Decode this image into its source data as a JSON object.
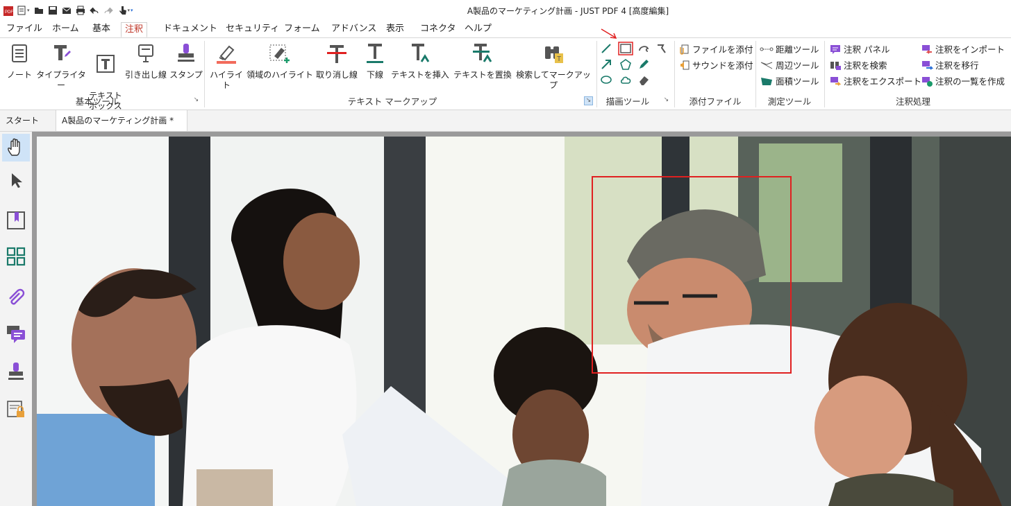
{
  "window": {
    "title": "A製品のマーケティング計画 - JUST PDF 4 [高度編集]"
  },
  "menu_tabs": [
    "ファイル",
    "ホーム",
    "基本",
    "注釈",
    "ドキュメント",
    "セキュリティ",
    "フォーム",
    "アドバンス",
    "表示",
    "コネクタ",
    "ヘルプ"
  ],
  "active_menu_tab": "注釈",
  "ribbon": {
    "basic_tools": {
      "label": "基本ツール",
      "buttons": [
        "ノート",
        "タイプライター",
        "テキスト\nボックス",
        "引き出し線",
        "スタンプ"
      ]
    },
    "text_markup": {
      "label": "テキスト マークアップ",
      "buttons": [
        "ハイライト",
        "領域のハイライト",
        "取り消し線",
        "下線",
        "テキストを挿入",
        "テキストを置換",
        "検索してマークアップ"
      ]
    },
    "drawing_tools": {
      "label": "描画ツール",
      "tools": [
        "line-icon",
        "rectangle-icon",
        "cloud-arc-icon",
        "eraser-pin-icon",
        "arrow-icon",
        "polygon-icon",
        "pencil-icon",
        "ellipse-icon",
        "cloud-icon",
        "eraser-icon"
      ]
    },
    "attach": {
      "label": "添付ファイル",
      "buttons": [
        "ファイルを添付",
        "サウンドを添付"
      ]
    },
    "measure": {
      "label": "測定ツール",
      "buttons": [
        "距離ツール",
        "周辺ツール",
        "面積ツール"
      ]
    },
    "annot_process": {
      "label": "注釈処理",
      "buttons": [
        "注釈 パネル",
        "注釈を検索",
        "注釈をエクスポート",
        "注釈をインポート",
        "注釈を移行",
        "注釈の一覧を作成"
      ]
    }
  },
  "doc_tabs": {
    "start": "スタート",
    "active": "A製品のマーケティング計画 *",
    "close": "×"
  },
  "sidebar": [
    "hand-tool-icon",
    "select-arrow-icon",
    "bookmark-icon",
    "thumbnails-icon",
    "attachment-icon",
    "comments-icon",
    "stamp-icon",
    "security-icon"
  ],
  "colors": {
    "accent_red": "#e02020",
    "purple": "#8a4fd6",
    "teal": "#1a7a6a"
  }
}
